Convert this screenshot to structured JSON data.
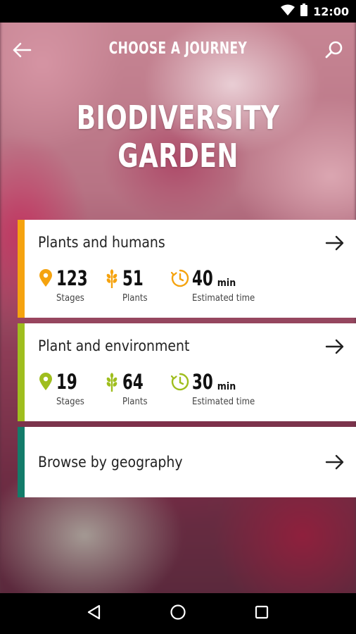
{
  "status_bar": {
    "time": "12:00",
    "icons": [
      "wifi-icon",
      "battery-icon"
    ]
  },
  "header": {
    "title": "CHOOSE A JOURNEY",
    "back_icon": "arrow-left-icon",
    "search_icon": "search-icon"
  },
  "garden": {
    "title": "BIODIVERSITY GARDEN"
  },
  "journeys": [
    {
      "title": "Plants and humans",
      "accent_color": "#f5a30f",
      "stages_value": "123",
      "stages_label": "Stages",
      "plants_value": "51",
      "plants_label": "Plants",
      "time_value": "40",
      "time_unit": "min",
      "time_label": "Estimated time"
    },
    {
      "title": "Plant and environment",
      "accent_color": "#9fbe1e",
      "stages_value": "19",
      "stages_label": "Stages",
      "plants_value": "64",
      "plants_label": "Plants",
      "time_value": "30",
      "time_unit": "min",
      "time_label": "Estimated time"
    }
  ],
  "browse": {
    "title": "Browse by geography",
    "accent_color": "#137c6a"
  },
  "nav_bar": {
    "icons": [
      "back-triangle-icon",
      "home-circle-icon",
      "recents-square-icon"
    ]
  }
}
